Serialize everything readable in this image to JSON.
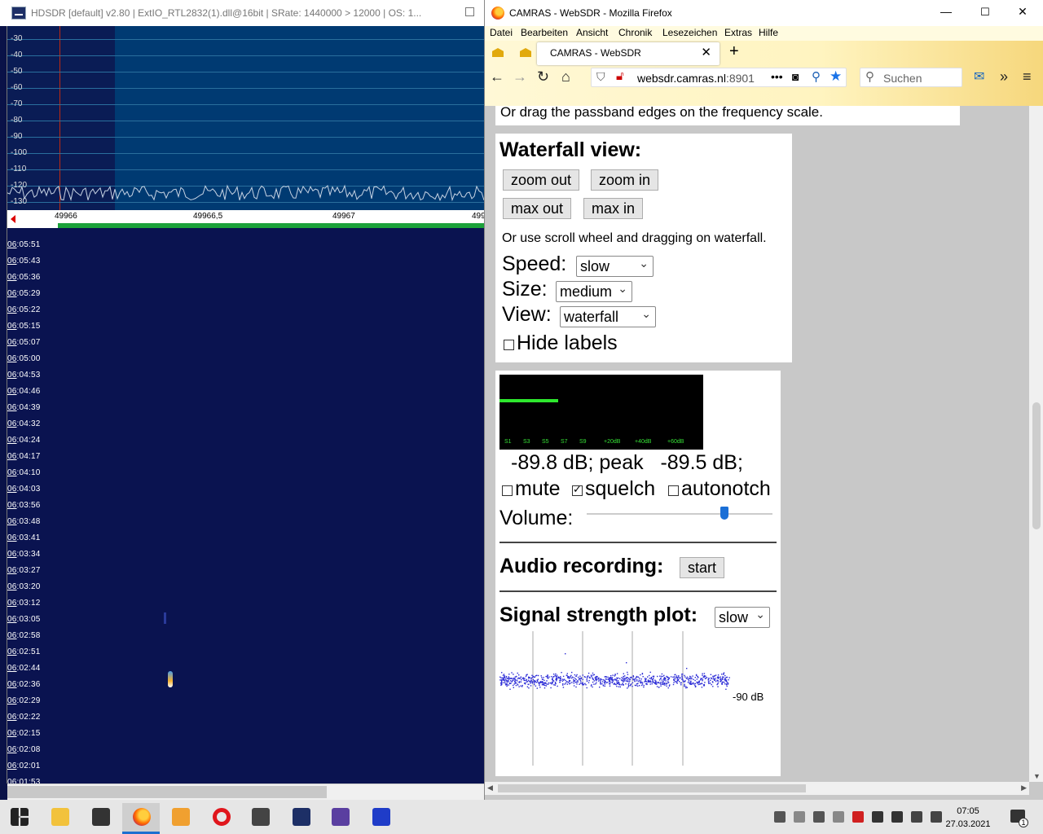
{
  "hdsdr": {
    "title": "HDSDR  [default]  v2.80   |  ExtIO_RTL2832(1).dll@16bit  |  SRate: 1440000 > 12000  |  OS: 1...",
    "db_labels": [
      "-30",
      "-40",
      "-50",
      "-60",
      "-70",
      "-80",
      "-90",
      "-100",
      "-110",
      "-120",
      "-130"
    ],
    "freq_labels": [
      "49966",
      "49966,5",
      "49967",
      "499"
    ],
    "time_labels": [
      "06:05:51",
      "06:05:43",
      "06:05:36",
      "06:05:29",
      "06:05:22",
      "06:05:15",
      "06:05:07",
      "06:05:00",
      "06:04:53",
      "06:04:46",
      "06:04:39",
      "06:04:32",
      "06:04:24",
      "06:04:17",
      "06:04:10",
      "06:04:03",
      "06:03:56",
      "06:03:48",
      "06:03:41",
      "06:03:34",
      "06:03:27",
      "06:03:20",
      "06:03:12",
      "06:03:05",
      "06:02:58",
      "06:02:51",
      "06:02:44",
      "06:02:36",
      "06:02:29",
      "06:02:22",
      "06:02:15",
      "06:02:08",
      "06:02:01",
      "06:01:53"
    ]
  },
  "firefox": {
    "title": "CAMRAS - WebSDR - Mozilla Firefox",
    "menu": [
      "Datei",
      "Bearbeiten",
      "Ansicht",
      "Chronik",
      "Lesezeichen",
      "Extras",
      "Hilfe"
    ],
    "tab_title": "CAMRAS - WebSDR",
    "url_host": "websdr.camras.nl",
    "url_port": ":8901",
    "search_placeholder": "Suchen"
  },
  "page": {
    "passband_hint": "Or drag the passband edges on the frequency scale.",
    "waterfall_heading": "Waterfall view:",
    "zoom_out": "zoom out",
    "zoom_in": "zoom in",
    "max_out": "max out",
    "max_in": "max in",
    "scroll_hint": "Or use scroll wheel and dragging on waterfall.",
    "speed_label": "Speed:",
    "speed_value": "slow",
    "size_label": "Size:",
    "size_value": "medium",
    "view_label": "View:",
    "view_value": "waterfall",
    "hide_labels": "Hide labels",
    "smeter_labels": [
      "S1",
      "S3",
      "S5",
      "S7",
      "S9",
      "+20dB",
      "+40dB",
      "+60dB"
    ],
    "level_text": "-89.8 dB; peak   -89.5 dB;",
    "mute": "mute",
    "squelch": "squelch",
    "autonotch": "autonotch",
    "volume_label": "Volume:",
    "volume_level": 0.74,
    "audio_heading": "Audio recording:",
    "start": "start",
    "signal_heading": "Signal strength plot:",
    "signal_speed": "slow",
    "plot_label": "-90 dB"
  },
  "taskbar": {
    "time": "07:05",
    "date": "27.03.2021",
    "notification_count": "1"
  },
  "colors": {
    "waterfall_bg": "#0a1350",
    "spectrum_bg": "#003a72",
    "smeter_green": "#2ee82e",
    "taskbar_accent": "#1d6fd0"
  }
}
